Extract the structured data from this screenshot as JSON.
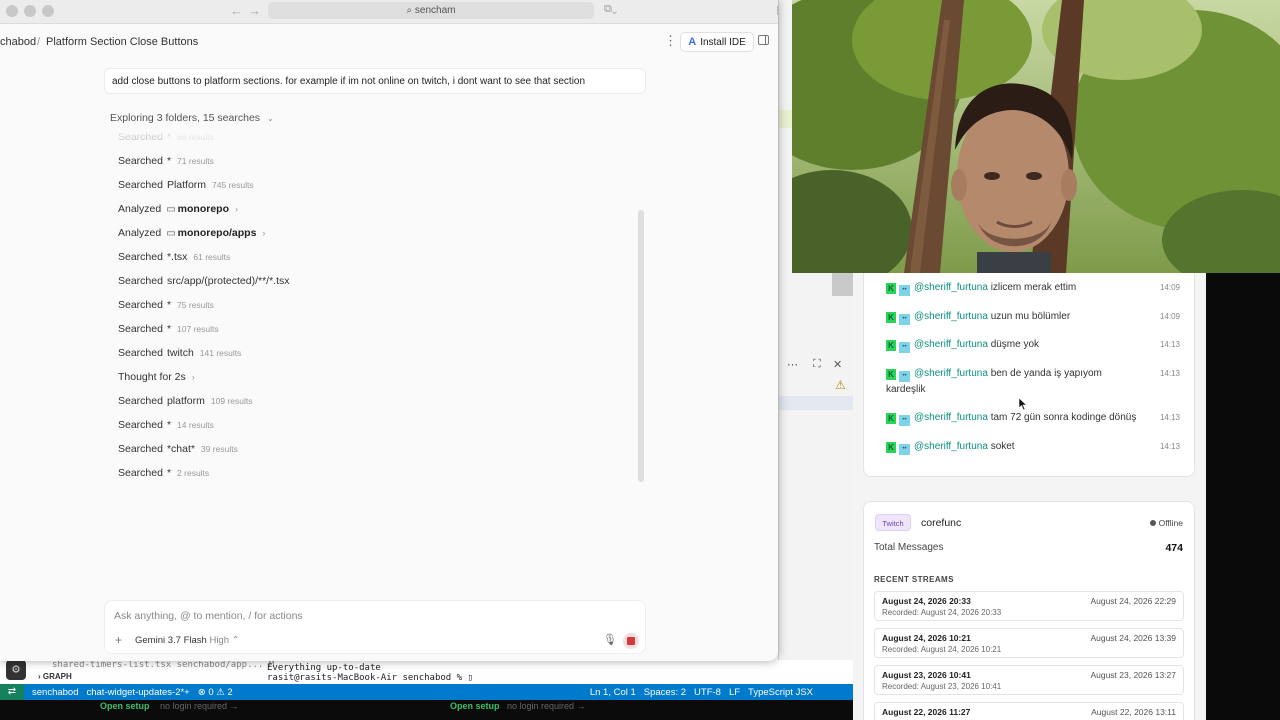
{
  "window": {
    "url": "sencham"
  },
  "header": {
    "breadcrumb_root": "chabod",
    "breadcrumb_sep": "/",
    "breadcrumb_current": "Platform Section Close Buttons",
    "install_label": "Install IDE"
  },
  "prompt": "add close buttons to platform sections. for example if im not online on twitch, i dont want to see that section",
  "explore": {
    "prefix": "Exploring",
    "count_folders": "3 folders",
    "sep": ",",
    "count_searches": "15 searches"
  },
  "steps": [
    {
      "action": "Searched",
      "target": "*",
      "count": "68 results"
    },
    {
      "action": "Searched",
      "target": "*",
      "count": "71 results"
    },
    {
      "action": "Searched",
      "target": "Platform",
      "count": "745 results"
    },
    {
      "action": "Analyzed",
      "target": "monorepo",
      "count": ""
    },
    {
      "action": "Analyzed",
      "target": "monorepo/apps",
      "count": ""
    },
    {
      "action": "Searched",
      "target": "*.tsx",
      "count": "61 results"
    },
    {
      "action": "Searched",
      "target": "src/app/(protected)/**/*.tsx",
      "count": ""
    },
    {
      "action": "Searched",
      "target": "*",
      "count": "75 results"
    },
    {
      "action": "Searched",
      "target": "*",
      "count": "107 results"
    },
    {
      "action": "Searched",
      "target": "twitch",
      "count": "141 results"
    },
    {
      "action": "Thought for 2s",
      "target": "",
      "count": ""
    },
    {
      "action": "Searched",
      "target": "platform",
      "count": "109 results"
    },
    {
      "action": "Searched",
      "target": "*",
      "count": "14 results"
    },
    {
      "action": "Searched",
      "target": "*chat*",
      "count": "39 results"
    },
    {
      "action": "Searched",
      "target": "*",
      "count": "2 results"
    }
  ],
  "input": {
    "placeholder": "Ask anything, @ to mention, / for actions",
    "model": "Gemini 3.7 Flash",
    "model_level": "High"
  },
  "ide": {
    "terminal_lines": [
      "Everything up-to-date",
      "rasit@rasits-MacBook-Air senchabod % ▯"
    ],
    "terminal_left": "shared-timers-list.tsx  senchabod/app...  M",
    "graph_label": "GRAPH",
    "status": {
      "project": "senchabod",
      "branch": "chat-widget-updates-2*+",
      "problems": "⊗ 0 ⚠ 2",
      "position": "Ln 1, Col 1",
      "spaces": "Spaces: 2",
      "encoding": "UTF-8",
      "eol": "LF",
      "language": "TypeScript JSX"
    },
    "footer": {
      "open_setup": "Open setup",
      "login": "no login required →"
    }
  },
  "chat_feed": [
    {
      "user": "@sheriff_furtuna",
      "text": "izlicem merak ettim",
      "time": "14:09"
    },
    {
      "user": "@sheriff_furtuna",
      "text": "uzun mu bölümler",
      "time": "14:09"
    },
    {
      "user": "@sheriff_furtuna",
      "text": "düşme yok",
      "time": "14:13"
    },
    {
      "user": "@sheriff_furtuna",
      "text": "ben de yanda iş yapıyom kardeşlik",
      "time": "14:13"
    },
    {
      "user": "@sheriff_furtuna",
      "text": "tam 72 gün sonra kodinge dönüş",
      "time": "14:13"
    },
    {
      "user": "@sheriff_furtuna",
      "text": "soket",
      "time": "14:13"
    }
  ],
  "channel_card": {
    "platform": "Twitch",
    "name": "corefunc",
    "status": "Offline",
    "total_label": "Total Messages",
    "total_value": "474",
    "recent_label": "RECENT STREAMS",
    "streams": [
      {
        "start": "August 24, 2026 20:33",
        "recorded": "Recorded: August 24, 2026 20:33",
        "end": "August 24, 2026 22:29"
      },
      {
        "start": "August 24, 2026 10:21",
        "recorded": "Recorded: August 24, 2026 10:21",
        "end": "August 24, 2026 13:39"
      },
      {
        "start": "August 23, 2026 10:41",
        "recorded": "Recorded: August 23, 2026 10:41",
        "end": "August 23, 2026 13:27"
      },
      {
        "start": "August 22, 2026 11:27",
        "recorded": "",
        "end": "August 22, 2026 13:11"
      }
    ]
  },
  "colors": {
    "accent_blue": "#007acc",
    "kick_green": "#2bd35b",
    "twitch_purple": "#6b3fb3",
    "username_teal": "#0b8f7f",
    "stop_red": "#d23a3a"
  },
  "icons": [
    "search-icon",
    "back-arrow-icon",
    "forward-arrow-icon",
    "folder-icon",
    "chevron-right-icon",
    "chevron-down-icon",
    "plus-icon",
    "mic-icon",
    "stop-icon",
    "kebab-icon",
    "panel-toggle-icon",
    "gear-icon",
    "kick-icon",
    "emote-badge-icon",
    "cursor-icon"
  ]
}
